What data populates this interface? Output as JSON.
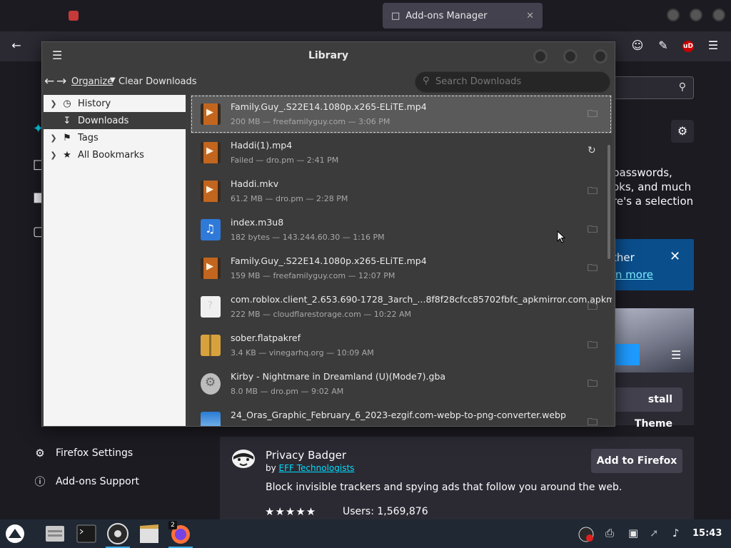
{
  "firefox": {
    "active_tab": "Add-ons Manager",
    "tab_close": "✕",
    "addons": {
      "partial_lines": [
        "passwords,",
        "oks, and much",
        "re's a selection"
      ],
      "banner_text": "ther",
      "banner_link": "rn more",
      "install_theme": "stall Theme",
      "settings_link": "Firefox Settings",
      "support_link": "Add-ons Support"
    },
    "privacy_badger": {
      "title": "Privacy Badger",
      "by_prefix": "by",
      "author": "EFF Technologists",
      "description": "Block invisible trackers and spying ads that follow you around the web.",
      "rating": "★★★★★",
      "users": "Users: 1,569,876",
      "add_button": "Add to Firefox"
    }
  },
  "library": {
    "title": "Library",
    "toolbar": {
      "organize": "Organize",
      "clear_downloads": "Clear Downloads",
      "search_placeholder": "Search Downloads"
    },
    "sidebar": [
      {
        "label": "History",
        "icon": "clock-icon",
        "selected": false
      },
      {
        "label": "Downloads",
        "icon": "download-icon",
        "selected": true
      },
      {
        "label": "Tags",
        "icon": "tags-icon",
        "selected": false
      },
      {
        "label": "All Bookmarks",
        "icon": "star-icon",
        "selected": false
      }
    ],
    "downloads": [
      {
        "name": "Family.Guy_.S22E14.1080p.x265-ELiTE.mp4",
        "status": "200 MB — freefamilyguy.com — 3:06 PM",
        "type": "film",
        "action": "folder"
      },
      {
        "name": "Haddi(1).mp4",
        "status": "Failed — dro.pm — 2:41 PM",
        "type": "film",
        "action": "retry"
      },
      {
        "name": "Haddi.mkv",
        "status": "61.2 MB — dro.pm — 2:28 PM",
        "type": "film",
        "action": "folder"
      },
      {
        "name": "index.m3u8",
        "status": "182 bytes — 143.244.60.30 — 1:16 PM",
        "type": "music",
        "action": "folder"
      },
      {
        "name": "Family.Guy_.S22E14.1080p.x265-ELiTE.mp4",
        "status": "159 MB — freefamilyguy.com — 12:07 PM",
        "type": "film",
        "action": "folder"
      },
      {
        "name": "com.roblox.client_2.653.690-1728_3arch_...8f8f28cfcc85702fbfc_apkmirror.com.apkm",
        "status": "222 MB — cloudflarestorage.com — 10:22 AM",
        "type": "blank",
        "action": "folder"
      },
      {
        "name": "sober.flatpakref",
        "status": "3.4 KB — vinegarhq.org — 10:09 AM",
        "type": "archive",
        "action": "folder"
      },
      {
        "name": "Kirby - Nightmare in Dreamland (U)(Mode7).gba",
        "status": "8.0 MB — dro.pm — 9:02 AM",
        "type": "gear",
        "action": "folder"
      },
      {
        "name": "24_Oras_Graphic_February_6_2023-ezgif.com-webp-to-png-converter.webp",
        "status": "",
        "type": "image",
        "action": "folder"
      }
    ]
  },
  "taskbar": {
    "firefox_badge": "2",
    "clock": "15:43"
  }
}
